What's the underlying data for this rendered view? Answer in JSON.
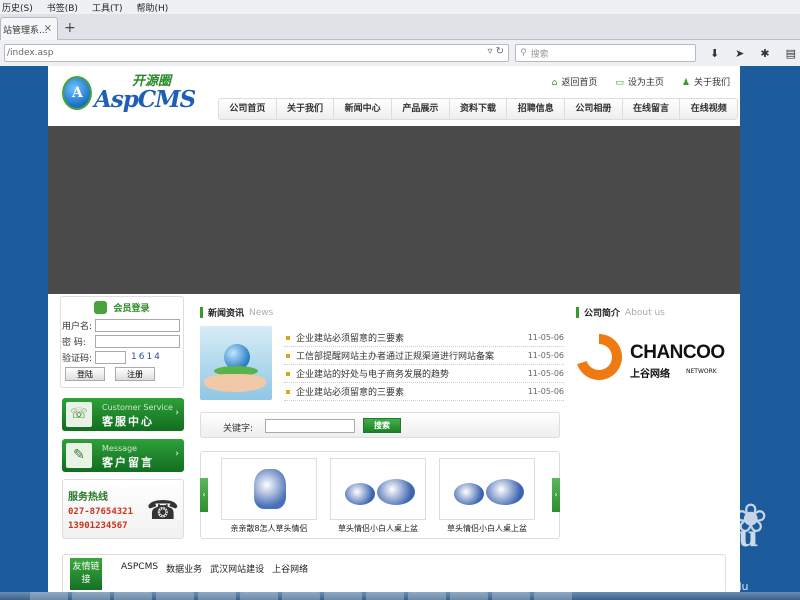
{
  "browser": {
    "menu": [
      "历史(S)",
      "书签(B)",
      "工具(T)",
      "帮助(H)"
    ],
    "tab_title": "站管理系...",
    "tab_close": "×",
    "new_tab": "+",
    "url": "/index.asp",
    "search_placeholder": "搜索"
  },
  "site": {
    "logo_cn": "开源圈",
    "logo_en": "AspCMS",
    "logo_mark": "A",
    "toplinks": [
      "返回首页",
      "设为主页",
      "关于我们"
    ],
    "nav": [
      "公司首页",
      "关于我们",
      "新闻中心",
      "产品展示",
      "资料下载",
      "招聘信息",
      "公司相册",
      "在线留言",
      "在线视频"
    ],
    "login": {
      "title": "会员登录",
      "username_label": "用户名:",
      "password_label": "密  码:",
      "captcha_label": "验证码:",
      "captcha_value": "1614",
      "login_button": "登陆",
      "register_button": "注册"
    },
    "service": {
      "en": "Customer Service",
      "cn": "客服中心"
    },
    "message": {
      "en": "Message",
      "cn": "客户留言"
    },
    "hotline": {
      "label": "服务热线",
      "numbers": [
        "027-87654321",
        "13901234567"
      ]
    },
    "news": {
      "title": "新闻资讯",
      "title_en": "News",
      "items": [
        {
          "title": "企业建站必须留意的三要素",
          "date": "11-05-06"
        },
        {
          "title": "工信部提醒网站主办者通过正规渠道进行网站备案",
          "date": "11-05-06"
        },
        {
          "title": "企业建站的好处与电子商务发展的趋势",
          "date": "11-05-06"
        },
        {
          "title": "企业建站必须留意的三要素",
          "date": "11-05-06"
        }
      ]
    },
    "search": {
      "label": "关键字:",
      "button": "搜索"
    },
    "products": [
      {
        "caption": "亲亲散8怎人草头情侣"
      },
      {
        "caption": "草头情侣小白人桌上盆"
      },
      {
        "caption": "草头情侣小白人桌上盆"
      }
    ],
    "company": {
      "title": "公司简介",
      "title_en": "About us",
      "logo_en": "CHANCOO",
      "logo_cn": "上谷网络",
      "logo_net": "NETWORK"
    },
    "friend": {
      "tag": "友情链接",
      "links": [
        "ASPCMS",
        "数据业务",
        "武汉网站建设",
        "上谷网络"
      ]
    }
  },
  "watermark": {
    "text": "Baidu",
    "sub": "jingyan.baidu"
  },
  "colors": {
    "accent_green": "#3a9a2f",
    "page_bg": "#1c5b9c",
    "banner": "#4b4b4b",
    "hotline_red": "#c8331d"
  }
}
